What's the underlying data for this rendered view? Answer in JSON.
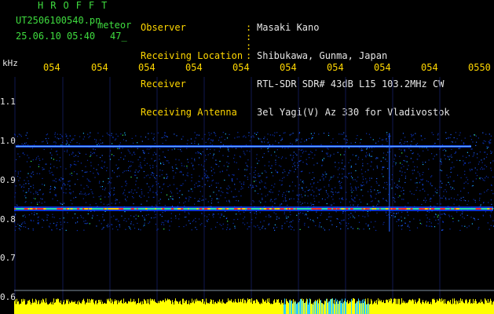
{
  "header": {
    "app_title": "HROFFT",
    "file_name": "UT2506100540.pn",
    "meteor_label": "meteor",
    "date_time": "25.06.10 05:40",
    "count": "47_"
  },
  "info": [
    {
      "label": "Observer",
      "value": "Masaki Kano"
    },
    {
      "label": "Receiving Location",
      "value": "Shibukawa, Gunma, Japan"
    },
    {
      "label": "Receiver",
      "value": "RTL-SDR SDR# 43dB L15 103.2MHz CW"
    },
    {
      "label": "Receiving Antenna",
      "value": "3el Yagi(V) Az 330 for Vladivostok"
    }
  ],
  "y_axis": {
    "unit": "kHz",
    "ticks": [
      "1.1",
      "1.0",
      "0.9",
      "0.8",
      "0.7",
      "0.6"
    ]
  },
  "x_axis": {
    "ticks": [
      "054",
      "054",
      "054",
      "054",
      "054",
      "054",
      "054",
      "054",
      "054",
      "0550"
    ]
  },
  "colors": {
    "green_text": "#3fdc3f",
    "yellow_text": "#ffd700",
    "white_text": "#e6e6e6",
    "signal_blue": "#1e50ff",
    "signal_red": "#ff3020",
    "bottom_bar_yellow": "#ffff00",
    "bottom_bar_cyan": "#30d0ff"
  }
}
